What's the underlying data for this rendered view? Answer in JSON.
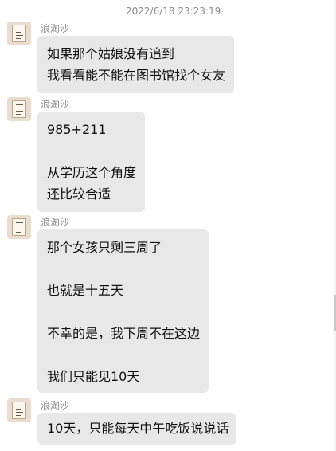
{
  "chat": {
    "timestamp": "2022/6/18 23:23:19",
    "messages": [
      {
        "sender": "浪淘沙",
        "lines": [
          "如果那个姑娘没有追到",
          "我看看能不能在图书馆找个女友"
        ]
      },
      {
        "sender": "浪淘沙",
        "lines": [
          "985+211",
          "",
          "从学历这个角度",
          "还比较合适"
        ]
      },
      {
        "sender": "浪淘沙",
        "lines": [
          "那个女孩只剩三周了",
          "",
          "也就是十五天",
          "",
          "不幸的是，我下周不在这边",
          "",
          "我们只能见10天"
        ]
      },
      {
        "sender": "浪淘沙",
        "lines": [
          "10天，只能每天中午吃饭说说话"
        ]
      }
    ]
  }
}
